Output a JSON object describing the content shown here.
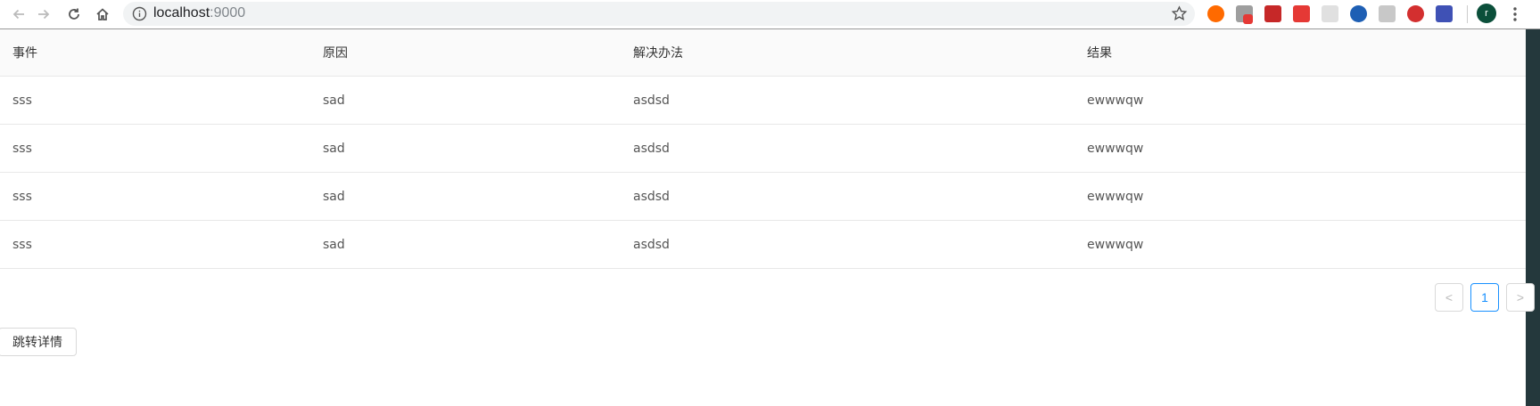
{
  "browser": {
    "url_host": "localhost",
    "url_port": ":9000",
    "avatar_letter": "r"
  },
  "table": {
    "columns": [
      "事件",
      "原因",
      "解决办法",
      "结果"
    ],
    "rows": [
      [
        "sss",
        "sad",
        "asdsd",
        "ewwwqw"
      ],
      [
        "sss",
        "sad",
        "asdsd",
        "ewwwqw"
      ],
      [
        "sss",
        "sad",
        "asdsd",
        "ewwwqw"
      ],
      [
        "sss",
        "sad",
        "asdsd",
        "ewwwqw"
      ]
    ]
  },
  "pagination": {
    "prev_label": "<",
    "current_page": "1",
    "next_label": ">"
  },
  "detail_button": {
    "label": "跳转详情"
  },
  "colors": {
    "accent": "#1890ff",
    "border": "#d9d9d9",
    "header_bg": "#fafafa"
  }
}
